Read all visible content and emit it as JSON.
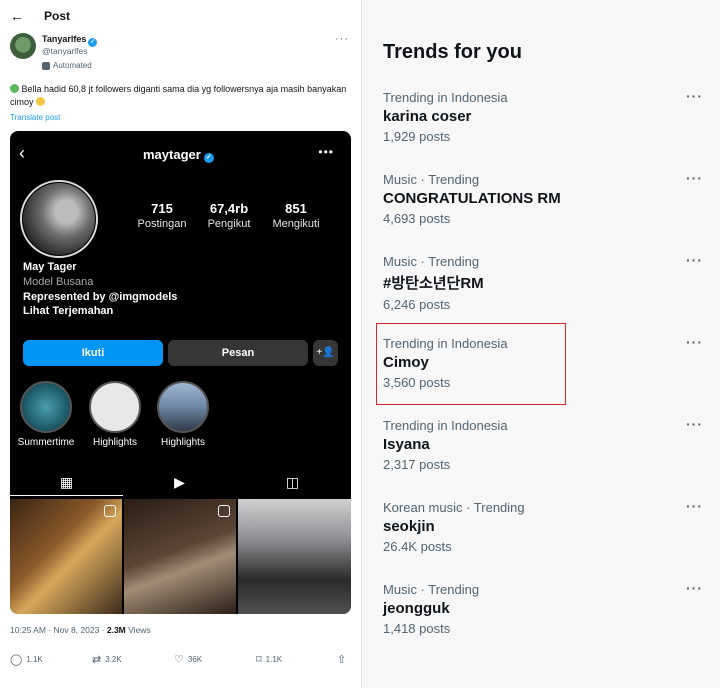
{
  "post": {
    "header_title": "Post",
    "author": {
      "name": "Tanyarlfes",
      "handle": "@tanyarlfes",
      "automated_label": "Automated"
    },
    "text": "Bella hadid 60,8 jt followers diganti sama dia yg followersnya aja masih banyakan cimoy",
    "translate_label": "Translate post",
    "instagram": {
      "username": "maytager",
      "stats": [
        {
          "num": "715",
          "label": "Postingan"
        },
        {
          "num": "67,4rb",
          "label": "Pengikut"
        },
        {
          "num": "851",
          "label": "Mengikuti"
        }
      ],
      "display_name": "May Tager",
      "category": "Model Busana",
      "represented": "Represented by @imgmodels",
      "see_translation": "Lihat Terjemahan",
      "follow_label": "Ikuti",
      "message_label": "Pesan",
      "highlights": [
        "Summertime",
        "Highlights",
        "Highlights"
      ]
    },
    "meta": {
      "time": "10:25 AM · Nov 8, 2023 · ",
      "views": "2.3M",
      "views_label": " Views"
    },
    "actions": {
      "replies": "1.1K",
      "reposts": "3.2K",
      "likes": "36K",
      "bookmarks": "1.1K"
    }
  },
  "trends": {
    "title": "Trends for you",
    "items": [
      {
        "context": "Trending in Indonesia",
        "name": "karina coser",
        "count": "1,929 posts"
      },
      {
        "context": "Music · Trending",
        "name": "CONGRATULATIONS RM",
        "count": "4,693 posts"
      },
      {
        "context": "Music · Trending",
        "name": "#방탄소년단RM",
        "count": "6,246 posts"
      },
      {
        "context": "Trending in Indonesia",
        "name": "Cimoy",
        "count": "3,560 posts"
      },
      {
        "context": "Trending in Indonesia",
        "name": "Isyana",
        "count": "2,317 posts"
      },
      {
        "context": "Korean music · Trending",
        "name": "seokjin",
        "count": "26.4K posts"
      },
      {
        "context": "Music · Trending",
        "name": "jeongguk",
        "count": "1,418 posts"
      }
    ]
  },
  "colors": {
    "accent": "#1d9bf0",
    "ig_follow": "#0095f6",
    "highlight_box": "#e0232b"
  }
}
